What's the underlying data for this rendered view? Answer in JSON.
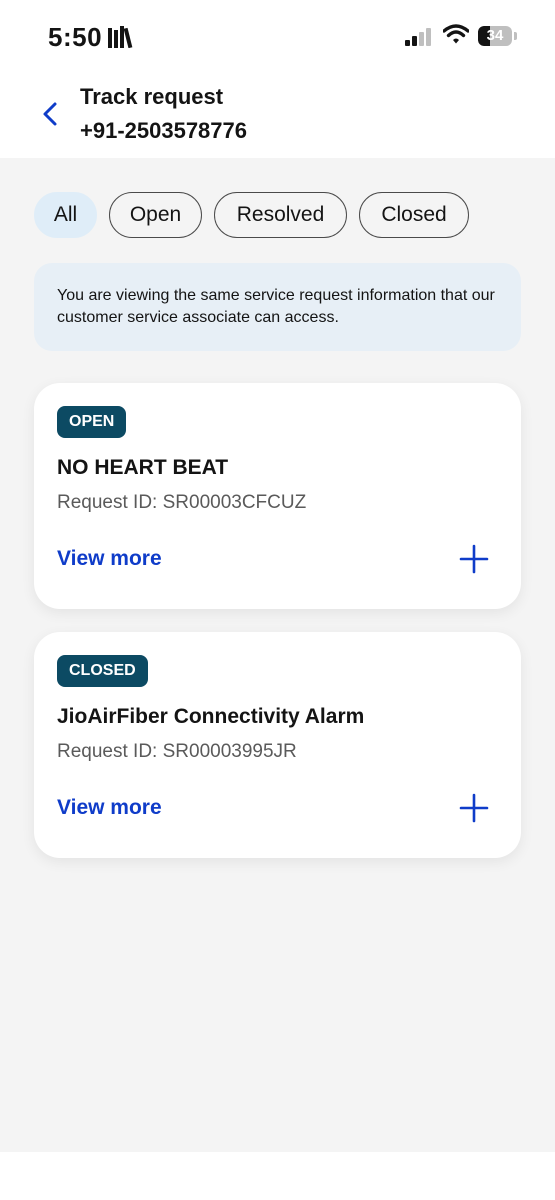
{
  "status_bar": {
    "time": "5:50",
    "battery_level": "34",
    "battery_fraction": 0.34
  },
  "header": {
    "title": "Track request",
    "phone": "+91-2503578776"
  },
  "filters": {
    "chips": [
      "All",
      "Open",
      "Resolved",
      "Closed"
    ],
    "selected": "All"
  },
  "info_box": {
    "text": "You are viewing the same service request information that our customer service associate can access."
  },
  "requests": [
    {
      "status": "OPEN",
      "title": "NO HEART BEAT",
      "request_id": "Request ID: SR00003CFCUZ",
      "view_more_label": "View more"
    },
    {
      "status": "CLOSED",
      "title": "JioAirFiber Connectivity Alarm",
      "request_id": "Request ID: SR00003995JR",
      "view_more_label": "View more"
    }
  ],
  "colors": {
    "accent_blue": "#0f3cc9",
    "badge_bg": "#0c4a63",
    "chip_active_bg": "#dfedf8",
    "info_bg": "#e7eff6",
    "page_bg": "#f4f4f4"
  },
  "icons": {
    "back": "chevron-left-icon",
    "plus": "plus-icon",
    "library": "library-books-icon",
    "signal": "cellular-signal-icon",
    "wifi": "wifi-icon",
    "battery": "battery-icon"
  }
}
